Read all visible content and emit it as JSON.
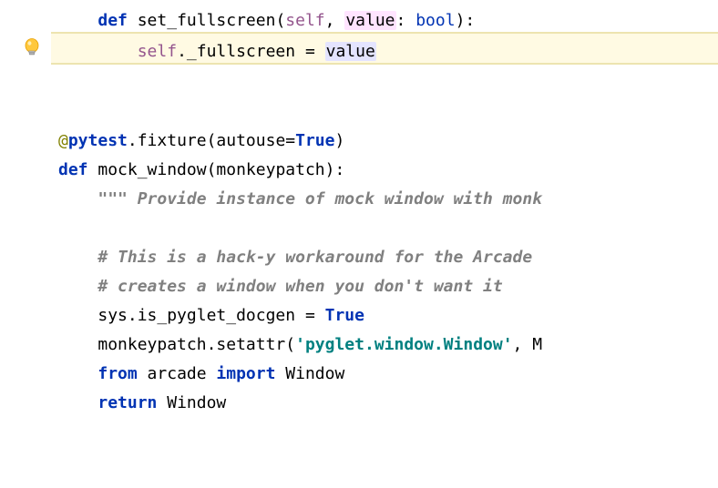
{
  "code": {
    "line1": {
      "kw_def": "def",
      "func_name": "set_fullscreen",
      "paren_open": "(",
      "self": "self",
      "comma1": ", ",
      "param": "value",
      "colon_type": ": ",
      "type": "bool",
      "paren_close_colon": "):"
    },
    "line2": {
      "indent": "    ",
      "self": "self",
      "dot_attr": "._fullscreen",
      "equals": " = ",
      "value": "value"
    },
    "line5": {
      "at": "@",
      "pytest": "pytest",
      "dot": ".",
      "fixture": "fixture",
      "paren_open": "(",
      "autouse": "autouse",
      "eq": "=",
      "true": "True",
      "paren_close": ")"
    },
    "line6": {
      "kw_def": "def",
      "func_name": "mock_window",
      "paren_open": "(",
      "param": "monkeypatch",
      "paren_close_colon": "):"
    },
    "line7": {
      "docstring": "\"\"\" Provide instance of mock window with monk"
    },
    "line9": {
      "comment": "# This is a hack-y workaround for the Arcade "
    },
    "line10": {
      "comment": "# creates a window when you don't want it"
    },
    "line11": {
      "sys": "sys",
      "attr": ".is_pyglet_docgen",
      "equals": " = ",
      "true": "True"
    },
    "line12": {
      "obj": "monkeypatch",
      "method": ".setattr",
      "paren_open": "(",
      "str": "'pyglet.window.Window'",
      "comma": ", ",
      "rest": "M"
    },
    "line13": {
      "from": "from",
      "module": " arcade ",
      "import": "import",
      "name": " Window"
    },
    "line14": {
      "return": "return",
      "name": " Window"
    }
  },
  "icons": {
    "bulb": "lightbulb-icon"
  }
}
